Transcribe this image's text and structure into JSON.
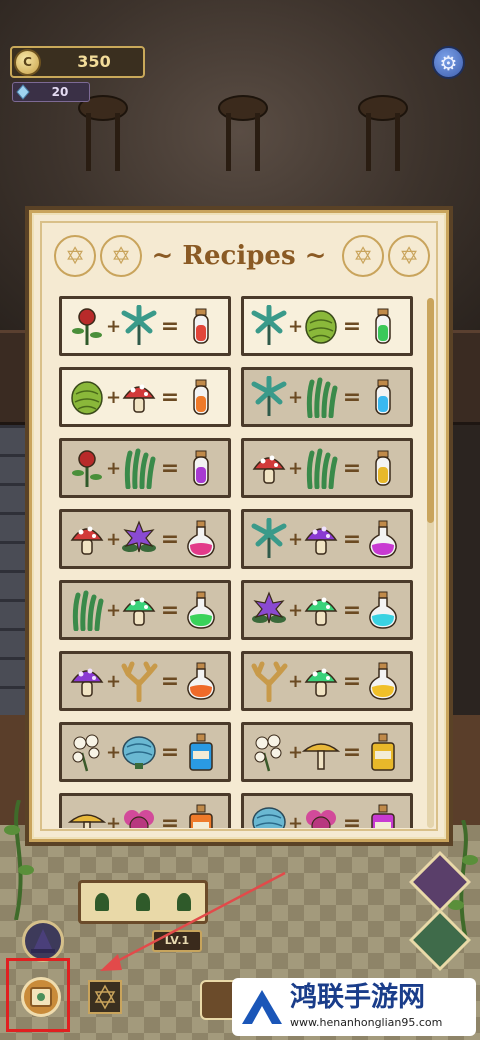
{
  "hud": {
    "coin_symbol": "C",
    "coins": "350",
    "gems": "20"
  },
  "panel": {
    "title": "~ Recipes ~",
    "colors": {
      "frame": "#c9a45c",
      "title": "#8a5a24",
      "card_light": "#f8f0dc",
      "card_dark": "#cfc2aa"
    }
  },
  "recipes": [
    {
      "a": "rose-icon",
      "b": "palm-leaf-icon",
      "result": "vial-red-icon",
      "style": "light"
    },
    {
      "a": "palm-leaf-icon",
      "b": "hops-icon",
      "result": "vial-green-icon",
      "style": "light"
    },
    {
      "a": "hops-icon",
      "b": "red-mushroom-icon",
      "result": "vial-orange-icon",
      "style": "light"
    },
    {
      "a": "palm-leaf-icon",
      "b": "grass-icon",
      "result": "vial-blue-icon",
      "style": "dark"
    },
    {
      "a": "rose-icon",
      "b": "grass-icon",
      "result": "vial-purple-icon",
      "style": "dark"
    },
    {
      "a": "red-mushroom-icon",
      "b": "grass-icon",
      "result": "vial-yellow-icon",
      "style": "dark"
    },
    {
      "a": "red-mushroom-icon",
      "b": "purple-flower-icon",
      "result": "flask-pink-icon",
      "style": "dark"
    },
    {
      "a": "palm-leaf-icon",
      "b": "purple-mushroom-icon",
      "result": "flask-magenta-icon",
      "style": "dark"
    },
    {
      "a": "grass-icon",
      "b": "green-mushroom-icon",
      "result": "flask-green-icon",
      "style": "dark"
    },
    {
      "a": "purple-flower-icon",
      "b": "green-mushroom-icon",
      "result": "flask-cyan-icon",
      "style": "dark"
    },
    {
      "a": "purple-mushroom-icon",
      "b": "coral-root-icon",
      "result": "flask-orange-icon",
      "style": "dark"
    },
    {
      "a": "coral-root-icon",
      "b": "green-mushroom-icon",
      "result": "flask-yellow-icon",
      "style": "dark"
    },
    {
      "a": "white-flower-icon",
      "b": "blue-shell-icon",
      "result": "bottle-blue-icon",
      "style": "dark"
    },
    {
      "a": "white-flower-icon",
      "b": "yellow-mushroom-icon",
      "result": "bottle-yellow-icon",
      "style": "dark"
    },
    {
      "a": "yellow-mushroom-icon",
      "b": "pink-flower-icon",
      "result": "bottle-orange-icon",
      "style": "dark"
    },
    {
      "a": "blue-shell-icon",
      "b": "pink-flower-icon",
      "result": "bottle-magenta-icon",
      "style": "dark"
    }
  ],
  "floor": {
    "level_badge": "LV.1"
  },
  "watermark": {
    "brand": "鸿联手游网",
    "url": "www.henanhonglian95.com"
  }
}
